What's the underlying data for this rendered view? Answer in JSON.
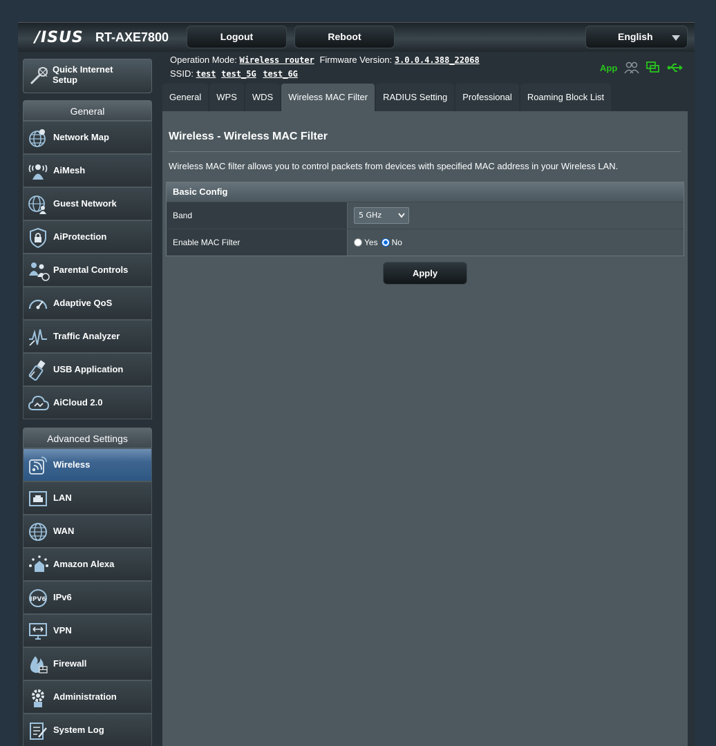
{
  "header": {
    "logo": "/ISUS",
    "model": "RT-AXE7800",
    "logout_label": "Logout",
    "reboot_label": "Reboot",
    "language": "English"
  },
  "info": {
    "operation_mode_label": "Operation Mode:",
    "operation_mode_value": "Wireless router",
    "firmware_label": "Firmware Version:",
    "firmware_value": "3.0.0.4.388_22068",
    "ssid_label": "SSID:",
    "ssids": [
      "test",
      "test_5G",
      "test_6G"
    ],
    "app_label": "App"
  },
  "sidebar": {
    "qis_label_1": "Quick Internet",
    "qis_label_2": "Setup",
    "general_header": "General",
    "general_items": [
      {
        "label": "Network Map",
        "icon": "globe-icon"
      },
      {
        "label": "AiMesh",
        "icon": "mesh-icon"
      },
      {
        "label": "Guest Network",
        "icon": "guest-network-icon"
      },
      {
        "label": "AiProtection",
        "icon": "shield-icon"
      },
      {
        "label": "Parental Controls",
        "icon": "parental-icon"
      },
      {
        "label": "Adaptive QoS",
        "icon": "gauge-icon"
      },
      {
        "label": "Traffic Analyzer",
        "icon": "traffic-icon"
      },
      {
        "label": "USB Application",
        "icon": "usb-icon"
      },
      {
        "label": "AiCloud 2.0",
        "icon": "cloud-icon"
      }
    ],
    "advanced_header": "Advanced Settings",
    "advanced_items": [
      {
        "label": "Wireless",
        "icon": "wireless-icon"
      },
      {
        "label": "LAN",
        "icon": "lan-icon"
      },
      {
        "label": "WAN",
        "icon": "wan-globe-icon"
      },
      {
        "label": "Amazon Alexa",
        "icon": "alexa-icon"
      },
      {
        "label": "IPv6",
        "icon": "ipv6-icon"
      },
      {
        "label": "VPN",
        "icon": "vpn-icon"
      },
      {
        "label": "Firewall",
        "icon": "firewall-icon"
      },
      {
        "label": "Administration",
        "icon": "gear-icon"
      },
      {
        "label": "System Log",
        "icon": "log-icon"
      }
    ]
  },
  "tabs": [
    "General",
    "WPS",
    "WDS",
    "Wireless MAC Filter",
    "RADIUS Setting",
    "Professional",
    "Roaming Block List"
  ],
  "active_tab": "Wireless MAC Filter",
  "main": {
    "title": "Wireless - Wireless MAC Filter",
    "description": "Wireless MAC filter allows you to control packets from devices with specified MAC address in your Wireless LAN.",
    "config_header": "Basic Config",
    "band_label": "Band",
    "band_value": "5 GHz",
    "mac_filter_label": "Enable MAC Filter",
    "yes_label": "Yes",
    "no_label": "No",
    "mac_filter_selected": "No",
    "apply_label": "Apply"
  },
  "colors": {
    "accent_active": "#3e6590",
    "app_green": "#28c31e",
    "content_bg": "#4d595f"
  }
}
